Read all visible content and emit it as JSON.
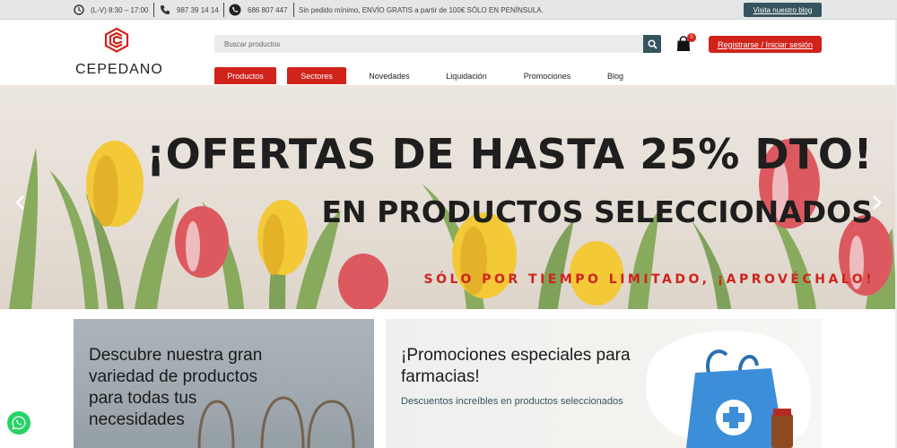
{
  "topbar": {
    "hours": "(L-V) 8:30 – 17:00",
    "phone": "987 39 14 14",
    "whatsapp": "686 807 447",
    "shipping": "Sin pedido mínimo, ENVÍO GRATIS a partir de 100€ SÓLO EN PENÍNSULA.",
    "blog_button": "Visita nuestro blog"
  },
  "header": {
    "logo_text": "CEPEDANO",
    "search_placeholder": "Buscar productos",
    "cart_count": "0",
    "login_button": "Registrarse / Iniciar sesión"
  },
  "nav": {
    "items": [
      "Productos",
      "Sectores",
      "Novedades",
      "Liquidación",
      "Promociones",
      "Blog"
    ]
  },
  "hero": {
    "headline": "¡OFERTAS DE HASTA 25% DTO!",
    "subheadline": "EN PRODUCTOS SELECCIONADOS",
    "tagline": "SÓLO POR TIEMPO LIMITADO, ¡APROVÉCHALO!",
    "prev_arrow": "‹",
    "next_arrow": "›"
  },
  "cards": {
    "products": {
      "title_line1": "Descubre nuestra gran",
      "title_line2": "variedad de productos",
      "title_line3": "para todas tus",
      "title_line4": "necesidades"
    },
    "pharmacy": {
      "title_line1": "¡Promociones especiales para",
      "title_line2": "farmacias!",
      "subtitle": "Descuentos increíbles en productos seleccionados"
    }
  },
  "colors": {
    "brand_red": "#d0231a",
    "dark_teal": "#35545e",
    "whatsapp_green": "#25d366"
  },
  "icons": [
    "clock-icon",
    "phone-icon",
    "whatsapp-icon",
    "search-icon",
    "cart-icon",
    "chevron-left-icon",
    "chevron-right-icon"
  ]
}
